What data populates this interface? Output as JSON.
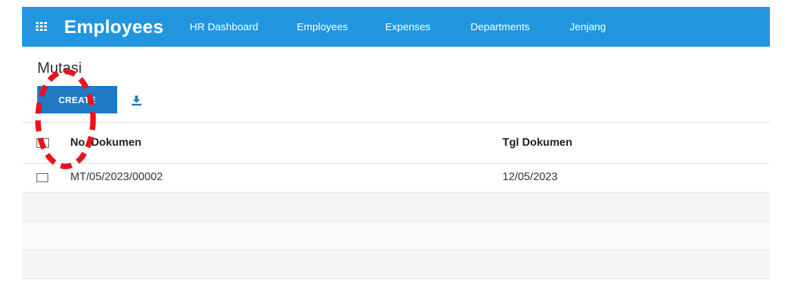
{
  "navbar": {
    "brand": "Employees",
    "menu": [
      "HR Dashboard",
      "Employees",
      "Expenses",
      "Departments",
      "Jenjang"
    ]
  },
  "page": {
    "title": "Mutasi",
    "create_label": "CREATE"
  },
  "table": {
    "columns": [
      "No. Dokumen",
      "Tgl Dokumen"
    ],
    "rows": [
      [
        "MT/05/2023/00002",
        "12/05/2023"
      ]
    ]
  },
  "colors": {
    "navbar": "#2196de",
    "create_button": "#1f79c3",
    "annotation": "#e8141c"
  }
}
